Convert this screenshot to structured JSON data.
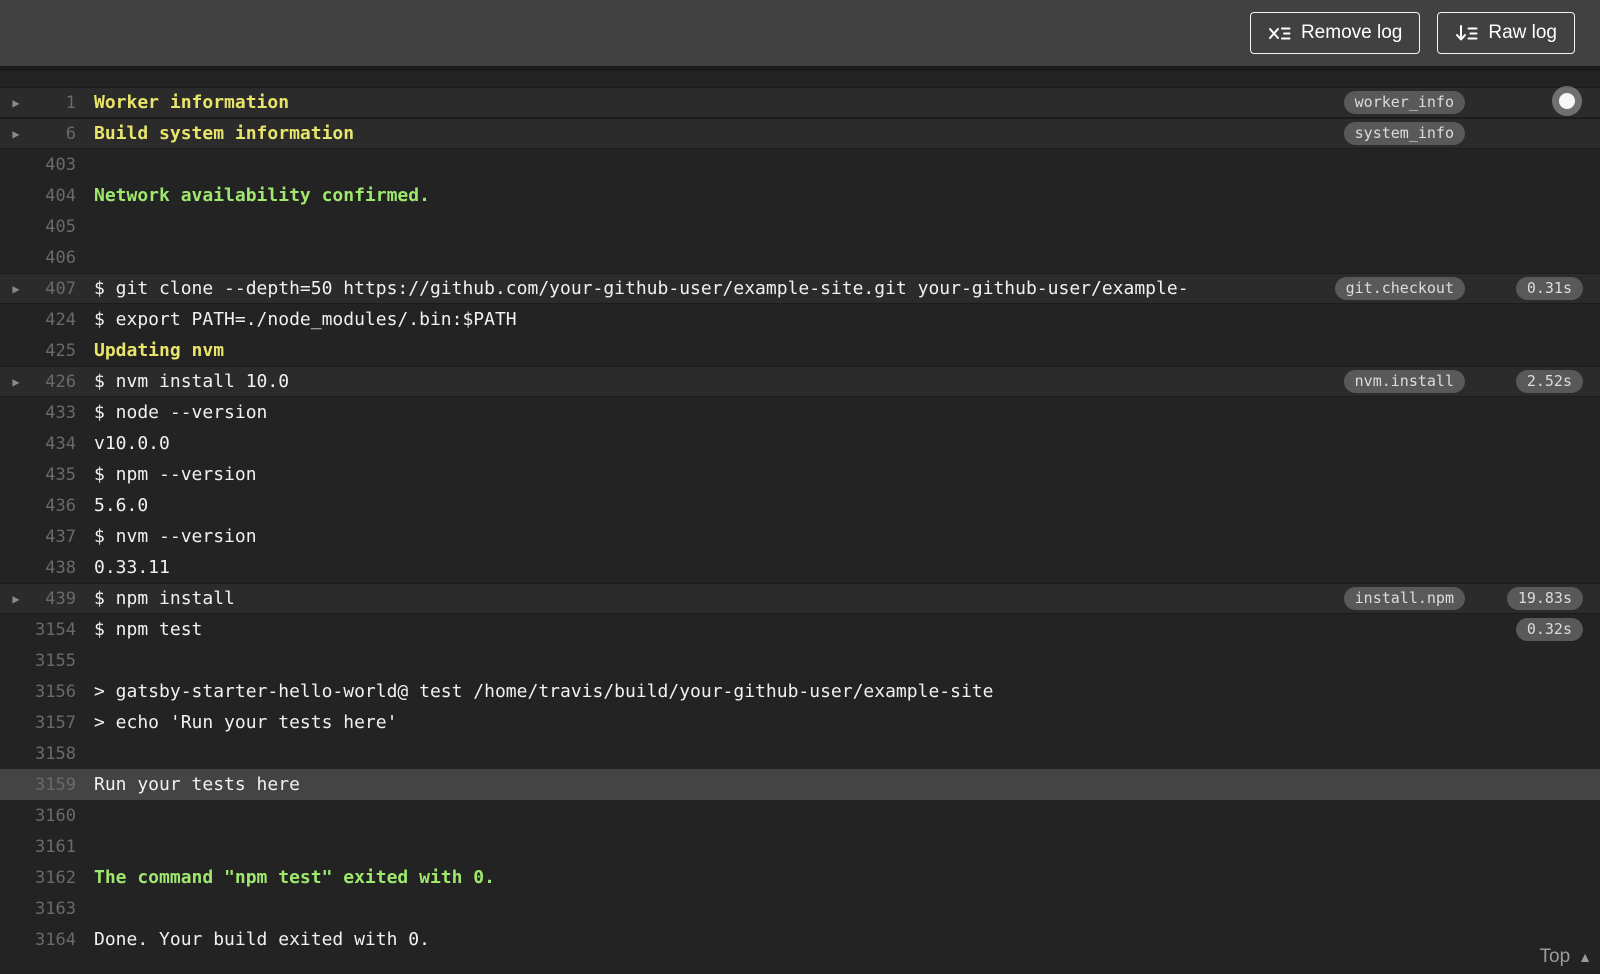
{
  "header": {
    "buttons": [
      {
        "label": "Remove log",
        "icon": "remove-log-icon"
      },
      {
        "label": "Raw log",
        "icon": "raw-log-icon"
      }
    ]
  },
  "log": {
    "icons": {
      "fold_arrow": "▶",
      "top_arrow": "▲"
    },
    "top_link_label": "Top",
    "lines": [
      {
        "n": "1",
        "text": "Worker information",
        "kind": "info",
        "fold": true,
        "badge": "worker_info"
      },
      {
        "n": "6",
        "text": "Build system information",
        "kind": "info",
        "fold": true,
        "badge": "system_info"
      },
      {
        "n": "403",
        "text": ""
      },
      {
        "n": "404",
        "text": "Network availability confirmed.",
        "kind": "success"
      },
      {
        "n": "405",
        "text": ""
      },
      {
        "n": "406",
        "text": ""
      },
      {
        "n": "407",
        "text": "$ git clone --depth=50 https://github.com/your-github-user/example-site.git your-github-user/example-",
        "fold": true,
        "badge": "git.checkout",
        "time": "0.31s"
      },
      {
        "n": "424",
        "text": "$ export PATH=./node_modules/.bin:$PATH"
      },
      {
        "n": "425",
        "text": "Updating nvm",
        "kind": "info"
      },
      {
        "n": "426",
        "text": "$ nvm install 10.0",
        "fold": true,
        "badge": "nvm.install",
        "time": "2.52s"
      },
      {
        "n": "433",
        "text": "$ node --version"
      },
      {
        "n": "434",
        "text": "v10.0.0"
      },
      {
        "n": "435",
        "text": "$ npm --version"
      },
      {
        "n": "436",
        "text": "5.6.0"
      },
      {
        "n": "437",
        "text": "$ nvm --version"
      },
      {
        "n": "438",
        "text": "0.33.11"
      },
      {
        "n": "439",
        "text": "$ npm install",
        "fold": true,
        "badge": "install.npm",
        "time": "19.83s"
      },
      {
        "n": "3154",
        "text": "$ npm test",
        "time": "0.32s"
      },
      {
        "n": "3155",
        "text": ""
      },
      {
        "n": "3156",
        "text": "> gatsby-starter-hello-world@ test /home/travis/build/your-github-user/example-site"
      },
      {
        "n": "3157",
        "text": "> echo 'Run your tests here'"
      },
      {
        "n": "3158",
        "text": ""
      },
      {
        "n": "3159",
        "text": "Run your tests here",
        "highlight": true
      },
      {
        "n": "3160",
        "text": ""
      },
      {
        "n": "3161",
        "text": ""
      },
      {
        "n": "3162",
        "text": "The command \"npm test\" exited with 0.",
        "kind": "success"
      },
      {
        "n": "3163",
        "text": ""
      },
      {
        "n": "3164",
        "text": "Done. Your build exited with 0."
      }
    ]
  },
  "colors": {
    "header_bg": "#414141",
    "log_bg": "#232323",
    "fold_row_bg": "#2b2b2b",
    "highlight_row_bg": "#444444",
    "text": "#f1f1f1",
    "line_number": "#6a6a6a",
    "yellow": "#e9e46a",
    "green": "#9fe86d",
    "badge_bg": "#595959",
    "badge_text": "#dcdcdc"
  }
}
